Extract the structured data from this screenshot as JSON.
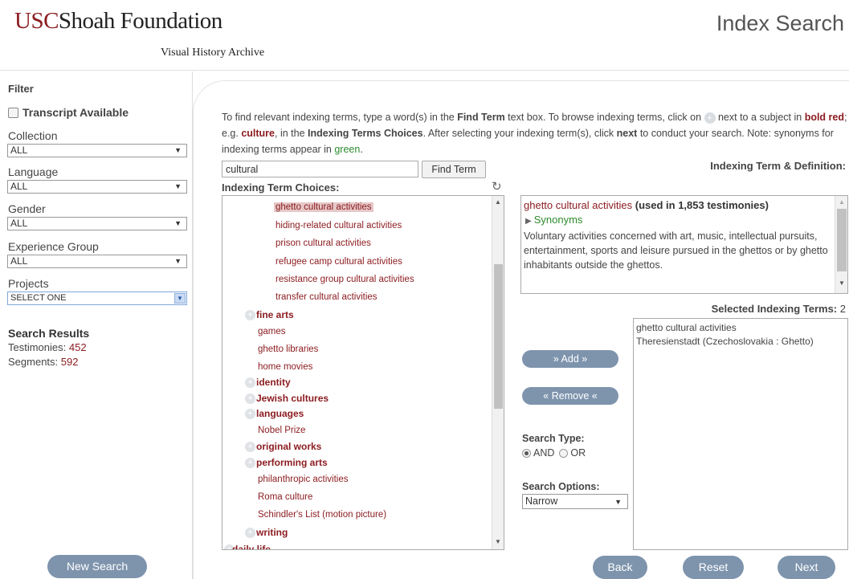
{
  "header": {
    "logo_usc": "USC",
    "logo_rest": "Shoah Foundation",
    "logo_sub": "Visual History Archive",
    "page_title": "Index Search"
  },
  "sidebar": {
    "filter_title": "Filter",
    "transcript_label": "Transcript Available",
    "collection_label": "Collection",
    "collection_value": "ALL",
    "language_label": "Language",
    "language_value": "ALL",
    "gender_label": "Gender",
    "gender_value": "ALL",
    "experience_label": "Experience Group",
    "experience_value": "ALL",
    "projects_label": "Projects",
    "projects_value": "SELECT ONE",
    "results_title": "Search Results",
    "testimonies_label": "Testimonies:",
    "testimonies_value": "452",
    "segments_label": "Segments:",
    "segments_value": "592",
    "new_search": "New Search"
  },
  "instructions": {
    "p1": "To find relevant indexing terms, type a word(s) in the ",
    "find_term": "Find Term",
    "p2": " text box. To browse indexing terms, click on ",
    "p3": " next to a subject in ",
    "bold_red": "bold red",
    "p4": "; e.g. ",
    "culture": "culture",
    "p5": ", in the ",
    "choices": "Indexing Terms Choices",
    "p6": ". After selecting your indexing term(s), click ",
    "next": "next",
    "p7": " to conduct your search. Note: synonyms for indexing terms appear in ",
    "green": "green",
    "p8": "."
  },
  "search": {
    "term_value": "cultural",
    "find_button": "Find Term",
    "choices_label": "Indexing Term Choices:"
  },
  "tree": [
    {
      "label": "ghetto cultural activities",
      "bold": false,
      "plus": false
    },
    {
      "label": "hiding-related cultural activities",
      "bold": false,
      "plus": false
    },
    {
      "label": "prison cultural activities",
      "bold": false,
      "plus": false
    },
    {
      "label": "refugee camp cultural activities",
      "bold": false,
      "plus": false
    },
    {
      "label": "resistance group cultural activities",
      "bold": false,
      "plus": false
    },
    {
      "label": "transfer cultural activities",
      "bold": false,
      "plus": false
    },
    {
      "label": "fine arts",
      "bold": true,
      "plus": true
    },
    {
      "label": "games",
      "bold": false,
      "plus": false
    },
    {
      "label": "ghetto libraries",
      "bold": false,
      "plus": false
    },
    {
      "label": "home movies",
      "bold": false,
      "plus": false
    },
    {
      "label": "identity",
      "bold": true,
      "plus": true
    },
    {
      "label": "Jewish cultures",
      "bold": true,
      "plus": true
    },
    {
      "label": "languages",
      "bold": true,
      "plus": true
    },
    {
      "label": "Nobel Prize",
      "bold": false,
      "plus": false
    },
    {
      "label": "original works",
      "bold": true,
      "plus": true
    },
    {
      "label": "performing arts",
      "bold": true,
      "plus": true
    },
    {
      "label": "philanthropic activities",
      "bold": false,
      "plus": false
    },
    {
      "label": "Roma culture",
      "bold": false,
      "plus": false
    },
    {
      "label": "Schindler's List (motion picture)",
      "bold": false,
      "plus": false
    },
    {
      "label": "writing",
      "bold": true,
      "plus": true
    },
    {
      "label": "daily life",
      "bold": true,
      "plus": true
    }
  ],
  "definition": {
    "label": "Indexing Term & Definition:",
    "term": "ghetto cultural activities",
    "usage": "(used in 1,853 testimonies)",
    "synonyms": "Synonyms",
    "text": "Voluntary activities concerned with art, music, intellectual pursuits, entertainment, sports and leisure pursued in the ghettos or by ghetto inhabitants outside the ghettos."
  },
  "selected": {
    "label": "Selected Indexing Terms:",
    "count": "2",
    "items": [
      "ghetto cultural activities",
      "Theresienstadt (Czechoslovakia : Ghetto)"
    ]
  },
  "actions": {
    "add": "» Add »",
    "remove": "« Remove «",
    "search_type_label": "Search Type:",
    "and_label": "AND",
    "or_label": "OR",
    "search_options_label": "Search Options:",
    "search_options_value": "Narrow",
    "back": "Back",
    "reset": "Reset",
    "next": "Next"
  },
  "colors": {
    "brand_red": "#8b1b1f",
    "button_blue": "#7e94ad",
    "synonym_green": "#2e8b2e"
  }
}
